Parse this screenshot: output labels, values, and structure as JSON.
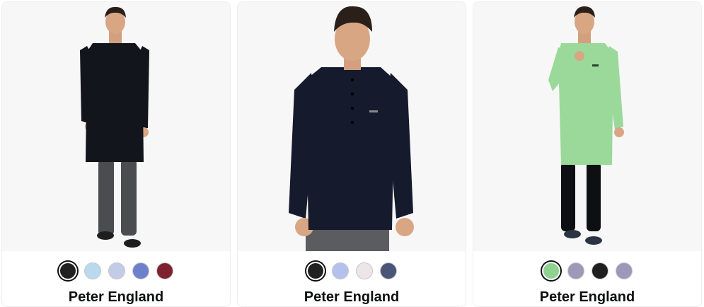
{
  "products": [
    {
      "brand": "Peter England",
      "image": "full-length-black-kurta-model",
      "garment_color": "#13151c",
      "bottom_color": "#4a4c50",
      "swatches": [
        "#212121",
        "#b9d9ee",
        "#c2cbe8",
        "#6e7fcb",
        "#7e2230"
      ],
      "selected": 0
    },
    {
      "brand": "Peter England",
      "image": "navy-short-kurta-model-upper-body",
      "garment_color": "#151a2c",
      "bottom_color": "#5a5c60",
      "swatches": [
        "#212121",
        "#b4c0ee",
        "#ece6e8",
        "#4a5678"
      ],
      "selected": 0
    },
    {
      "brand": "Peter England",
      "image": "full-length-green-kurta-model",
      "garment_color": "#9ad99a",
      "bottom_color": "#0e0f12",
      "swatches": [
        "#8fd18f",
        "#9d9ab8",
        "#1f1f1f",
        "#9c98b8"
      ],
      "selected": 0
    }
  ]
}
